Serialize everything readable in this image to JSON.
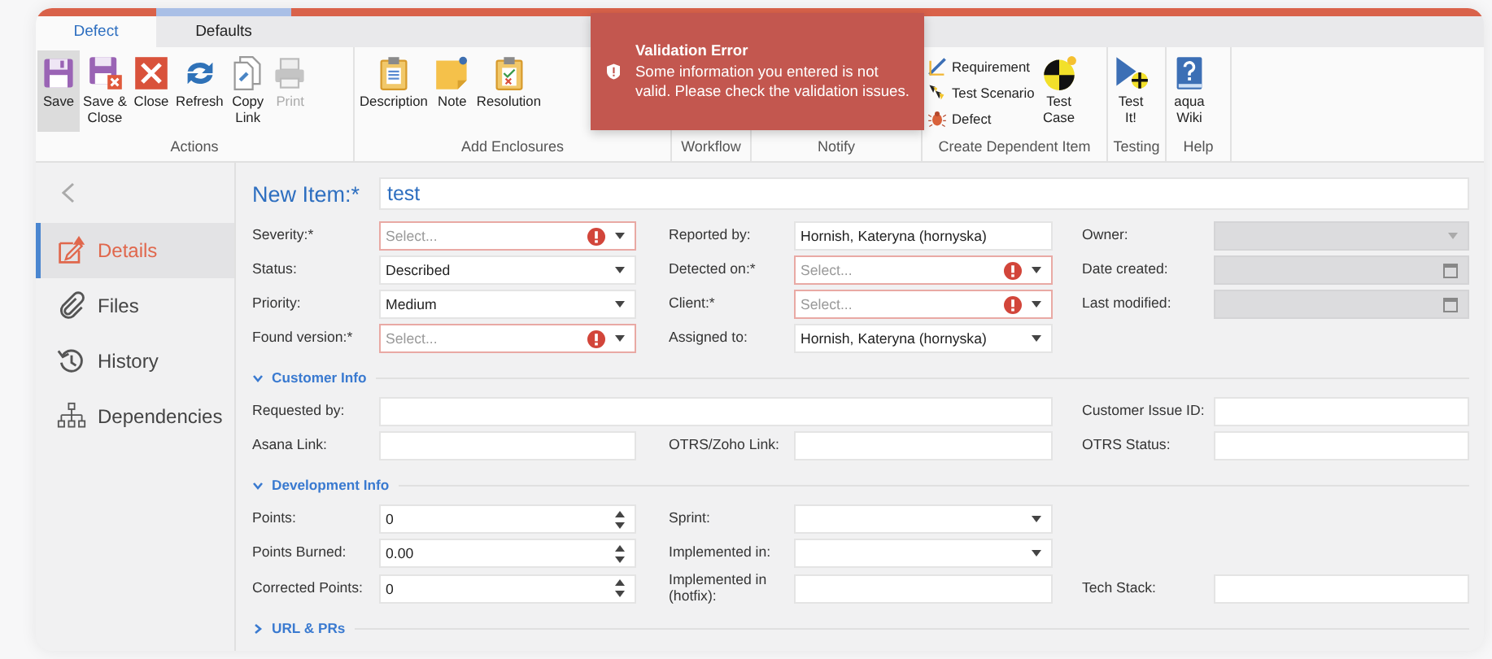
{
  "tabs": [
    {
      "label": "Defect",
      "selected": true
    },
    {
      "label": "Defaults",
      "selected": false
    }
  ],
  "ribbon": [
    {
      "title": "Actions",
      "items": [
        {
          "label": "Save",
          "kind": "large",
          "selected": true,
          "disabled": false
        },
        {
          "label": "Save &\nClose",
          "kind": "large",
          "selected": false,
          "disabled": false
        },
        {
          "label": "Close",
          "kind": "large",
          "selected": false,
          "disabled": false
        },
        {
          "label": "Refresh",
          "kind": "large",
          "selected": false,
          "disabled": false
        },
        {
          "label": "Copy\nLink",
          "kind": "large",
          "selected": false,
          "disabled": false
        },
        {
          "label": "Print",
          "kind": "large",
          "selected": false,
          "disabled": true
        }
      ]
    },
    {
      "title": "Add Enclosures",
      "items": [
        {
          "label": "Description",
          "kind": "large",
          "selected": false,
          "disabled": false
        },
        {
          "label": "Note",
          "kind": "large",
          "selected": false,
          "disabled": false
        },
        {
          "label": "Resolution",
          "kind": "large",
          "selected": false,
          "disabled": false
        }
      ]
    },
    {
      "title": "Workflow"
    },
    {
      "title": "Notify"
    },
    {
      "title": "Create Dependent Item",
      "items": [
        {
          "label": "Requirement",
          "kind": "small",
          "selected": false,
          "disabled": false
        },
        {
          "label": "Test Scenario",
          "kind": "small",
          "selected": false,
          "disabled": false
        },
        {
          "label": "Defect",
          "kind": "small",
          "selected": false,
          "disabled": false
        },
        {
          "label": "Test\nCase",
          "kind": "large",
          "selected": false,
          "disabled": false
        }
      ]
    },
    {
      "title": "Testing",
      "items": [
        {
          "label": "Test\nIt!",
          "kind": "large",
          "selected": false,
          "disabled": false
        }
      ]
    },
    {
      "title": "Help",
      "items": [
        {
          "label": "aqua\nWiki",
          "kind": "large",
          "selected": false,
          "disabled": false
        }
      ]
    }
  ],
  "toast": {
    "title": "Validation Error",
    "message": "Some information you entered is not valid. Please check the validation issues."
  },
  "sidebar": {
    "items": [
      {
        "label": "Details",
        "selected": true,
        "error": true
      },
      {
        "label": "Files",
        "selected": false,
        "error": false
      },
      {
        "label": "History",
        "selected": false,
        "error": false
      },
      {
        "label": "Dependencies",
        "selected": false,
        "error": false
      }
    ]
  },
  "form": {
    "title": "New Item:*",
    "name": "test",
    "rows": [
      [
        {
          "label": "Severity:*",
          "kind": "select",
          "placeholder": "Select...",
          "error": true,
          "disabled": false
        },
        {
          "label": "Reported by:",
          "kind": "text",
          "value": "Hornish, Kateryna (hornyska)",
          "error": false,
          "disabled": false
        },
        {
          "label": "Owner:",
          "kind": "select",
          "error": false,
          "disabled": true
        }
      ],
      [
        {
          "label": "Status:",
          "kind": "select",
          "value": "Described",
          "error": false,
          "disabled": false
        },
        {
          "label": "Detected on:*",
          "kind": "select",
          "placeholder": "Select...",
          "error": true,
          "disabled": false
        },
        {
          "label": "Date created:",
          "kind": "date",
          "error": false,
          "disabled": true
        }
      ],
      [
        {
          "label": "Priority:",
          "kind": "select",
          "value": "Medium",
          "error": false,
          "disabled": false
        },
        {
          "label": "Client:*",
          "kind": "select",
          "placeholder": "Select...",
          "error": true,
          "disabled": false
        },
        {
          "label": "Last modified:",
          "kind": "date",
          "error": false,
          "disabled": true
        }
      ],
      [
        {
          "label": "Found version:*",
          "kind": "select",
          "placeholder": "Select...",
          "error": true,
          "disabled": false
        },
        {
          "label": "Assigned to:",
          "kind": "select",
          "value": "Hornish, Kateryna (hornyska)",
          "error": false,
          "disabled": false
        }
      ]
    ],
    "sections": [
      {
        "title": "Customer Info",
        "expanded": true,
        "rows": [
          [
            {
              "label": "Requested by:",
              "kind": "text",
              "wide": true,
              "error": false,
              "disabled": false
            },
            "",
            {
              "label": "Customer Issue ID:",
              "kind": "text",
              "wide": false,
              "error": false,
              "disabled": false
            }
          ],
          [
            {
              "label": "Asana Link:",
              "kind": "text",
              "wide": false,
              "error": false,
              "disabled": false
            },
            {
              "label": "OTRS/Zoho Link:",
              "kind": "text",
              "wide": false,
              "error": false,
              "disabled": false
            },
            {
              "label": "OTRS Status:",
              "kind": "text",
              "wide": false,
              "error": false,
              "disabled": false
            }
          ]
        ]
      },
      {
        "title": "Development Info",
        "expanded": true,
        "rows": [
          [
            {
              "label": "Points:",
              "kind": "number",
              "value": "0",
              "error": false,
              "disabled": false
            },
            {
              "label": "Sprint:",
              "kind": "select",
              "error": false,
              "disabled": false
            }
          ],
          [
            {
              "label": "Points Burned:",
              "kind": "number",
              "value": "0.00",
              "error": false,
              "disabled": false
            },
            {
              "label": "Implemented in:",
              "kind": "select",
              "error": false,
              "disabled": false
            }
          ],
          [
            {
              "label": "Corrected Points:",
              "kind": "number",
              "value": "0",
              "error": false,
              "disabled": false
            },
            {
              "label": "Implemented in (hotfix):",
              "kind": "text",
              "error": false,
              "disabled": false
            },
            {
              "label": "Tech Stack:",
              "kind": "text",
              "error": false,
              "disabled": false
            }
          ]
        ]
      },
      {
        "title": "URL & PRs",
        "expanded": false
      }
    ]
  }
}
